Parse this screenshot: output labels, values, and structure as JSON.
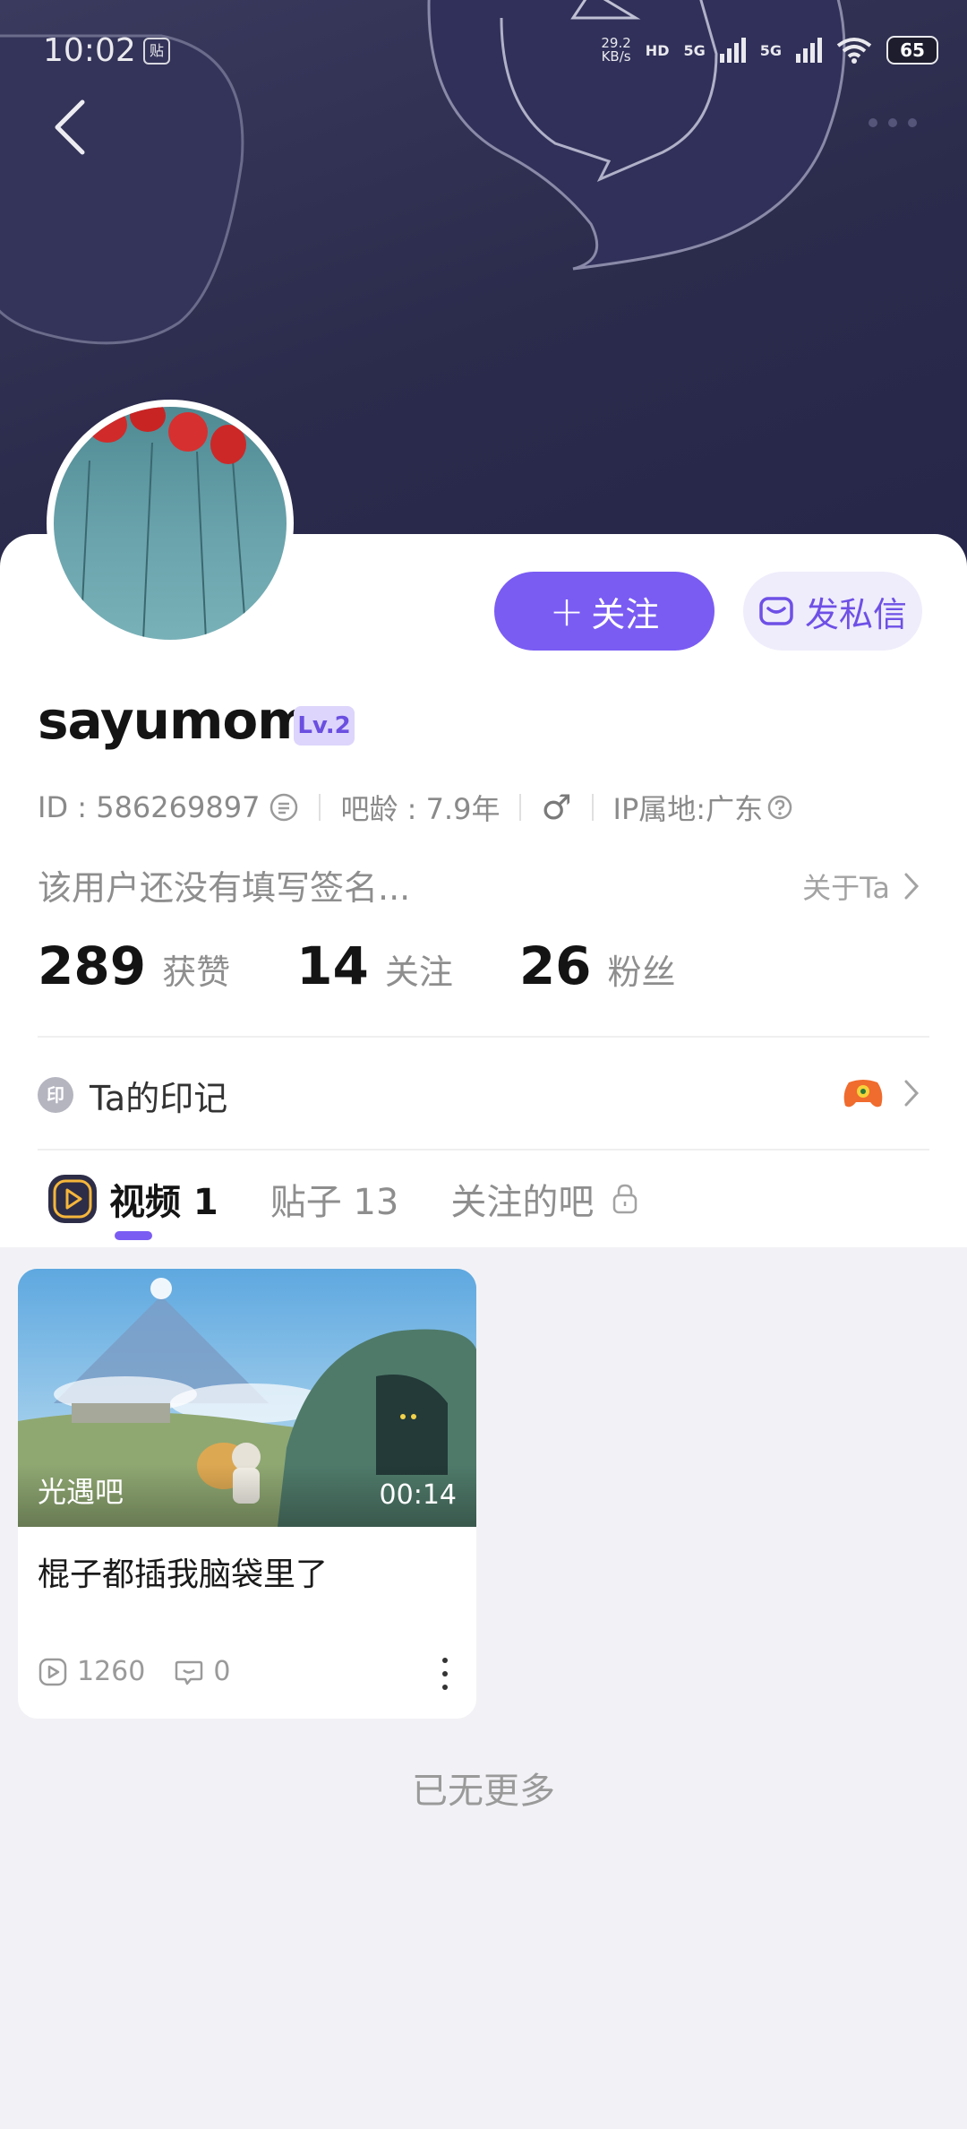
{
  "status_bar": {
    "time": "10:02",
    "app_icon_text": "贴",
    "net_speed_top": "29.2",
    "net_speed_bottom": "KB/s",
    "hd_tag": "HD",
    "sig1_tag": "5G",
    "sig2_tag": "5G",
    "battery": "65"
  },
  "nav": {
    "back_icon": "chevron-left-icon",
    "more_icon": "more-dots-icon"
  },
  "profile": {
    "username": "sayumom",
    "level": "Lv.2",
    "id_text": "ID : 586269897",
    "age_text": "吧龄 : 7.9年",
    "gender_symbol": "♂",
    "ip_text": "IP属地:广东",
    "signature": "该用户还没有填写签名...",
    "about_label": "关于Ta"
  },
  "actions": {
    "follow_plus": "+",
    "follow_label": "关注",
    "message_label": "发私信"
  },
  "stats": [
    {
      "num": "289",
      "label": "获赞"
    },
    {
      "num": "14",
      "label": "关注"
    },
    {
      "num": "26",
      "label": "粉丝"
    }
  ],
  "mark": {
    "icon_text": "印",
    "label": "Ta的印记"
  },
  "tabs": [
    {
      "label": "视频 1"
    },
    {
      "label": "贴子 13"
    },
    {
      "label": "关注的吧"
    }
  ],
  "video": {
    "forum": "光遇吧",
    "duration": "00:14",
    "title": "棍子都插我脑袋里了",
    "plays": "1260",
    "comments": "0"
  },
  "footer": {
    "end_text": "已无更多"
  },
  "colors": {
    "accent": "#7a5cf3",
    "banner": "#2b2b4c"
  }
}
